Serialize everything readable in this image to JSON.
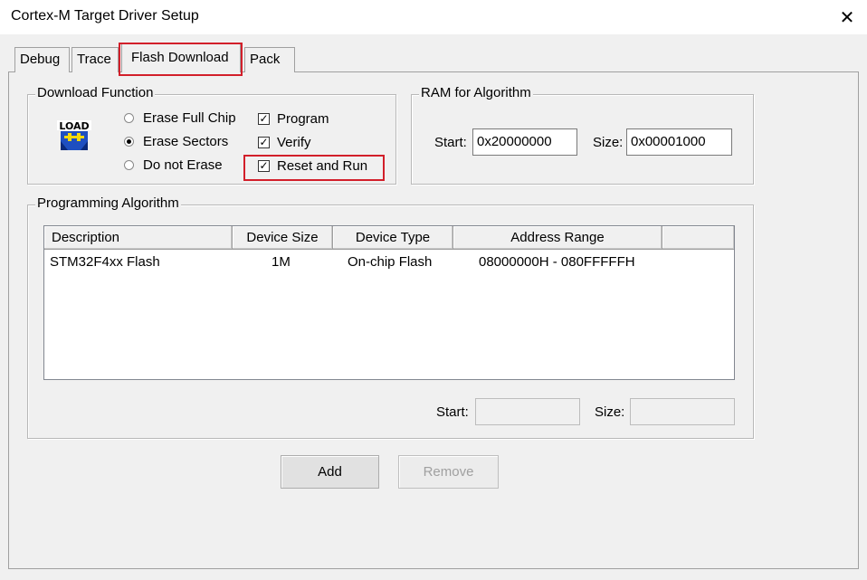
{
  "window": {
    "title": "Cortex-M Target Driver Setup",
    "close_glyph": "✕"
  },
  "tabs": [
    {
      "label": "Debug"
    },
    {
      "label": "Trace"
    },
    {
      "label": "Flash Download",
      "active": true
    },
    {
      "label": "Pack"
    }
  ],
  "download_function": {
    "title": "Download Function",
    "icon": "load-icon",
    "icon_text": "LOAD",
    "erase_options": [
      {
        "label": "Erase Full Chip",
        "selected": false
      },
      {
        "label": "Erase Sectors",
        "selected": true
      },
      {
        "label": "Do not Erase",
        "selected": false
      }
    ],
    "checks": [
      {
        "label": "Program",
        "checked": true
      },
      {
        "label": "Verify",
        "checked": true
      },
      {
        "label": "Reset and Run",
        "checked": true
      }
    ]
  },
  "ram_for_algorithm": {
    "title": "RAM for Algorithm",
    "start_label": "Start:",
    "start_value": "0x20000000",
    "size_label": "Size:",
    "size_value": "0x00001000"
  },
  "programming_algorithm": {
    "title": "Programming Algorithm",
    "columns": [
      "Description",
      "Device Size",
      "Device Type",
      "Address Range"
    ],
    "rows": [
      {
        "description": "STM32F4xx Flash",
        "device_size": "1M",
        "device_type": "On-chip Flash",
        "address_range": "08000000H - 080FFFFFH"
      }
    ],
    "start_label": "Start:",
    "start_value": "",
    "size_label": "Size:",
    "size_value": ""
  },
  "buttons": {
    "add": "Add",
    "remove": "Remove"
  },
  "colors": {
    "highlight": "#d21f2a",
    "window_bg": "#f0f0f0",
    "load_icon_blue": "#1e4fc0",
    "load_icon_yellow": "#f5d90a"
  }
}
